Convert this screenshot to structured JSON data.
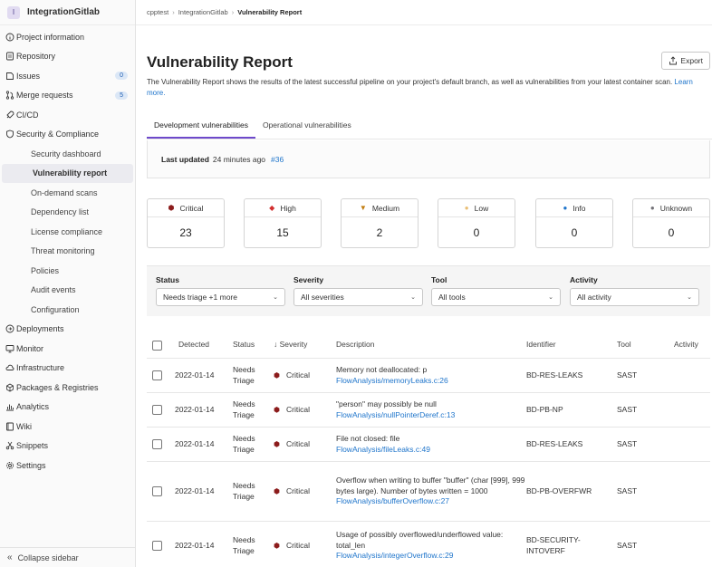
{
  "sidebar": {
    "project_initial": "I",
    "project_name": "IntegrationGitlab",
    "items": [
      {
        "label": "Project information",
        "icon": "info-icon"
      },
      {
        "label": "Repository",
        "icon": "document-icon"
      },
      {
        "label": "Issues",
        "icon": "issues-icon",
        "badge": "0"
      },
      {
        "label": "Merge requests",
        "icon": "merge-request-icon",
        "badge": "5"
      },
      {
        "label": "CI/CD",
        "icon": "rocket-icon"
      },
      {
        "label": "Security & Compliance",
        "icon": "shield-icon"
      },
      {
        "label": "Security dashboard"
      },
      {
        "label": "Vulnerability report"
      },
      {
        "label": "On-demand scans"
      },
      {
        "label": "Dependency list"
      },
      {
        "label": "License compliance"
      },
      {
        "label": "Threat monitoring"
      },
      {
        "label": "Policies"
      },
      {
        "label": "Audit events"
      },
      {
        "label": "Configuration"
      },
      {
        "label": "Deployments",
        "icon": "deployments-icon"
      },
      {
        "label": "Monitor",
        "icon": "monitor-icon"
      },
      {
        "label": "Infrastructure",
        "icon": "cloud-icon"
      },
      {
        "label": "Packages & Registries",
        "icon": "package-icon"
      },
      {
        "label": "Analytics",
        "icon": "chart-icon"
      },
      {
        "label": "Wiki",
        "icon": "book-icon"
      },
      {
        "label": "Snippets",
        "icon": "scissors-icon"
      },
      {
        "label": "Settings",
        "icon": "gear-icon"
      }
    ],
    "collapse_label": "Collapse sidebar"
  },
  "breadcrumb": {
    "items": [
      "cpptest",
      "IntegrationGitlab",
      "Vulnerability Report"
    ]
  },
  "header": {
    "title": "Vulnerability Report",
    "export_label": "Export",
    "description": "The Vulnerability Report shows the results of the latest successful pipeline on your project's default branch, as well as vulnerabilities from your latest container scan.",
    "learn_more": "Learn more."
  },
  "tabs": [
    {
      "label": "Development vulnerabilities"
    },
    {
      "label": "Operational vulnerabilities"
    }
  ],
  "last_updated": {
    "label": "Last updated",
    "ago": "24 minutes ago",
    "pipeline": "#36"
  },
  "severity_cards": [
    {
      "label": "Critical",
      "count": "23",
      "color": "#8c1c1c",
      "glyph": "⬢"
    },
    {
      "label": "High",
      "count": "15",
      "color": "#d22f2f",
      "glyph": "◆"
    },
    {
      "label": "Medium",
      "count": "2",
      "color": "#c17d10",
      "glyph": "▼"
    },
    {
      "label": "Low",
      "count": "0",
      "color": "#e9be74",
      "glyph": "●"
    },
    {
      "label": "Info",
      "count": "0",
      "color": "#1f75cb",
      "glyph": "●"
    },
    {
      "label": "Unknown",
      "count": "0",
      "color": "#737278",
      "glyph": "●"
    }
  ],
  "filters": [
    {
      "label": "Status",
      "value": "Needs triage +1 more"
    },
    {
      "label": "Severity",
      "value": "All severities"
    },
    {
      "label": "Tool",
      "value": "All tools"
    },
    {
      "label": "Activity",
      "value": "All activity"
    }
  ],
  "table": {
    "headers": {
      "detected": "Detected",
      "status": "Status",
      "severity": "↓ Severity",
      "description": "Description",
      "identifier": "Identifier",
      "tool": "Tool",
      "activity": "Activity"
    },
    "rows": [
      {
        "date": "2022-01-14",
        "status": "Needs Triage",
        "severity": "Critical",
        "desc": "Memory not deallocated: p",
        "file": "FlowAnalysis/memoryLeaks.c:26",
        "identifier": "BD-RES-LEAKS",
        "tool": "SAST"
      },
      {
        "date": "2022-01-14",
        "status": "Needs Triage",
        "severity": "Critical",
        "desc": "\"person\" may possibly be null",
        "file": "FlowAnalysis/nullPointerDeref.c:13",
        "identifier": "BD-PB-NP",
        "tool": "SAST"
      },
      {
        "date": "2022-01-14",
        "status": "Needs Triage",
        "severity": "Critical",
        "desc": "File not closed: file",
        "file": "FlowAnalysis/fileLeaks.c:49",
        "identifier": "BD-RES-LEAKS",
        "tool": "SAST"
      },
      {
        "date": "2022-01-14",
        "status": "Needs Triage",
        "severity": "Critical",
        "desc": "Overflow when writing to buffer \"buffer\" (char [999], 999 bytes large). Number of bytes written = 1000",
        "file": "FlowAnalysis/bufferOverflow.c:27",
        "identifier": "BD-PB-OVERFWR",
        "tool": "SAST"
      },
      {
        "date": "2022-01-14",
        "status": "Needs Triage",
        "severity": "Critical",
        "desc": "Usage of possibly overflowed/underflowed value: total_len",
        "file": "FlowAnalysis/integerOverflow.c:29",
        "identifier": "BD-SECURITY-INTOVERF",
        "tool": "SAST"
      }
    ]
  }
}
